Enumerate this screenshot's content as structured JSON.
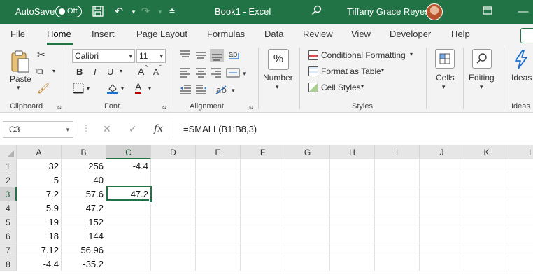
{
  "titlebar": {
    "autosave_label": "AutoSave",
    "autosave_state": "Off",
    "document": "Book1  -  Excel",
    "user": "Tiffany Grace Reyes"
  },
  "tabs": [
    "File",
    "Home",
    "Insert",
    "Page Layout",
    "Formulas",
    "Data",
    "Review",
    "View",
    "Developer",
    "Help"
  ],
  "active_tab": "Home",
  "ribbon": {
    "clipboard": {
      "paste": "Paste",
      "label": "Clipboard"
    },
    "font": {
      "name": "Calibri",
      "size": "11",
      "label": "Font",
      "bold": "B",
      "italic": "I",
      "underline": "U",
      "grow": "A",
      "shrink": "A",
      "color": "A"
    },
    "alignment": {
      "label": "Alignment"
    },
    "number": {
      "icon": "%",
      "label": "Number"
    },
    "styles": {
      "conditional": "Conditional Formatting",
      "table": "Format as Table",
      "cell_styles": "Cell Styles",
      "label": "Styles"
    },
    "cells": {
      "label": "Cells"
    },
    "editing": {
      "label": "Editing"
    },
    "ideas": {
      "label": "Ideas",
      "group": "Ideas"
    }
  },
  "formula_bar": {
    "name_box": "C3",
    "formula": "=SMALL(B1:B8,3)"
  },
  "sheet": {
    "columns": [
      "A",
      "B",
      "C",
      "D",
      "E",
      "F",
      "G",
      "H",
      "I",
      "J",
      "K",
      "L"
    ],
    "rows": [
      "1",
      "2",
      "3",
      "4",
      "5",
      "6",
      "7",
      "8"
    ],
    "selected_column": "C",
    "selected_row": "3",
    "colA": [
      "32",
      "5",
      "7.2",
      "5.9",
      "19",
      "18",
      "7.12",
      "-4.4"
    ],
    "colB": [
      "256",
      "40",
      "57.6",
      "47.2",
      "152",
      "144",
      "56.96",
      "-35.2"
    ],
    "colC": [
      "-4.4",
      "",
      "47.2",
      "",
      "",
      "",
      "",
      ""
    ]
  }
}
